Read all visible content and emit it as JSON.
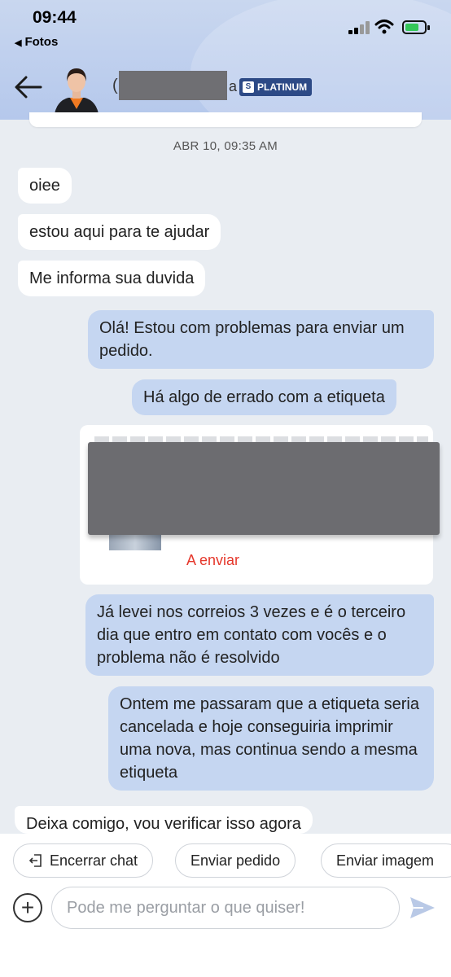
{
  "status_bar": {
    "time": "09:44",
    "back_app": "Fotos"
  },
  "header": {
    "name_prefix": "(",
    "name_suffix": "a",
    "badge": "PLATINUM"
  },
  "chat": {
    "date": "ABR 10, 09:35 AM",
    "messages": [
      {
        "from": "agent",
        "text": "oiee"
      },
      {
        "from": "agent",
        "text": "estou aqui para te ajudar"
      },
      {
        "from": "agent",
        "text": "Me informa sua  duvida"
      },
      {
        "from": "user",
        "text": "Olá! Estou com problemas para enviar um pedido."
      },
      {
        "from": "user",
        "text": "Há algo de errado com a etiqueta"
      },
      {
        "from": "user",
        "text": "Já levei nos correios 3 vezes e é o terceiro dia que entro em contato com vocês e o problema não é resolvido"
      },
      {
        "from": "user",
        "text": "Ontem me passaram que a etiqueta seria cancelada e hoje conseguiria imprimir uma nova, mas continua sendo a mesma etiqueta"
      },
      {
        "from": "agent",
        "text": "Deixa comigo, vou verificar isso agora"
      }
    ],
    "order_card": {
      "status": "A enviar"
    }
  },
  "quick_actions": [
    {
      "label": "Encerrar chat",
      "icon": "exit-icon"
    },
    {
      "label": "Enviar pedido"
    },
    {
      "label": "Enviar imagem"
    }
  ],
  "composer": {
    "placeholder": "Pode me perguntar o que quiser!"
  },
  "colors": {
    "accent": "#2d4a86",
    "user_bubble": "#c5d6f1",
    "status_red": "#e5372b"
  }
}
